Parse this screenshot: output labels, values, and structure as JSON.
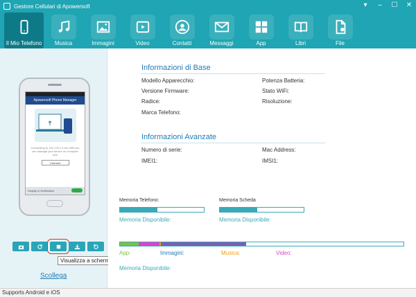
{
  "window": {
    "title": "Gestore Cellulari di Apowersoft",
    "controls": [
      "▾",
      "–",
      "☐",
      "✕"
    ]
  },
  "toolbar": {
    "tabs": [
      {
        "label": "Il Mio Telefono",
        "icon": "phone-icon",
        "active": true
      },
      {
        "label": "Musica",
        "icon": "music-note-icon",
        "active": false
      },
      {
        "label": "Immagini",
        "icon": "image-icon",
        "active": false
      },
      {
        "label": "Video",
        "icon": "play-icon",
        "active": false
      },
      {
        "label": "Contatti",
        "icon": "person-icon",
        "active": false
      },
      {
        "label": "Messaggi",
        "icon": "envelope-icon",
        "active": false
      },
      {
        "label": "App",
        "icon": "grid-icon",
        "active": false
      },
      {
        "label": "Libri",
        "icon": "book-icon",
        "active": false
      },
      {
        "label": "File",
        "icon": "file-icon",
        "active": false
      }
    ]
  },
  "phone_screen": {
    "app_title": "Apowersoft Phone Manager",
    "message": "Connecting to 192.178.1.4 via USB you can manage your device on computer now",
    "connect_button": "Connect",
    "notification_label": "Display in Notification",
    "toggle_label": "ON"
  },
  "left_controls": {
    "buttons": [
      "camera-icon",
      "refresh-icon",
      "fullscreen-icon",
      "download-icon",
      "restore-icon"
    ],
    "tooltip": "Visualizza a schermo pieno",
    "disconnect": "Scollega"
  },
  "info_base": {
    "title": "Informazioni di Base",
    "left": [
      "Modello Apparecchio:",
      "Versione Firmware:",
      "Radice:",
      "Marca Telefono:"
    ],
    "right": [
      "Potenza Batteria:",
      "Stato WiFi:",
      "Risoluzione:"
    ]
  },
  "info_adv": {
    "title": "Informazioni Avanzate",
    "left": [
      "Numero di serie:",
      "IMEI1:"
    ],
    "right": [
      "Mac Address:",
      "IMSI1:"
    ]
  },
  "memory": {
    "phone_label": "Memoria Telefono:",
    "phone_fill": 0.45,
    "phone_avail": "Memoria Disponibile:",
    "card_label": "Memoria Scheda",
    "card_fill": 0.45,
    "card_avail": "Memoria Disponibile:"
  },
  "usage": {
    "segments": [
      {
        "name": "App",
        "color": "#7cc142",
        "fraction": 0.065
      },
      {
        "name": "Immagini",
        "color": "#e042c8",
        "fraction": 0.075
      },
      {
        "name": "Musica",
        "color": "#f39c12",
        "fraction": 0.005
      },
      {
        "name": "Video",
        "color": "#7a5fb3",
        "fraction": 0.3
      }
    ],
    "legend": [
      "App:",
      "Immagini:",
      "Musica:",
      "Video:"
    ],
    "legend_colors": [
      "#7cc142",
      "#1f7ab5",
      "#f39c12",
      "#e042c8"
    ],
    "avail": "Memoria Disponibile:"
  },
  "status": {
    "text": "Supports Android e iOS"
  }
}
